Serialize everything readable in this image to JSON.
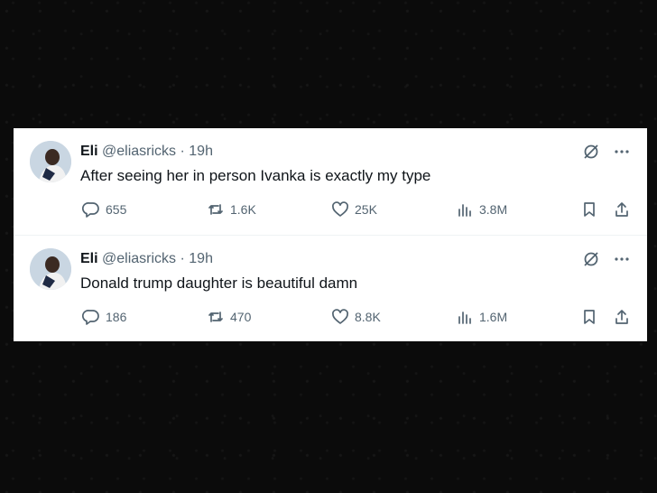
{
  "tweets": [
    {
      "name": "Eli",
      "handle": "@eliasricks",
      "time": "· 19h",
      "text": "After seeing her in person Ivanka is exactly my type",
      "replies": "655",
      "retweets": "1.6K",
      "likes": "25K",
      "views": "3.8M"
    },
    {
      "name": "Eli",
      "handle": "@eliasricks",
      "time": "· 19h",
      "text": "Donald trump daughter is beautiful damn",
      "replies": "186",
      "retweets": "470",
      "likes": "8.8K",
      "views": "1.6M"
    }
  ],
  "icons": {
    "grok": "grok-icon",
    "more": "more-icon",
    "reply": "reply-icon",
    "retweet": "retweet-icon",
    "like": "heart-icon",
    "views": "views-icon",
    "bookmark": "bookmark-icon",
    "share": "share-icon"
  },
  "colors": {
    "text": "#0f1419",
    "secondary": "#536471",
    "background": "#0b0b0b",
    "card": "#ffffff"
  }
}
